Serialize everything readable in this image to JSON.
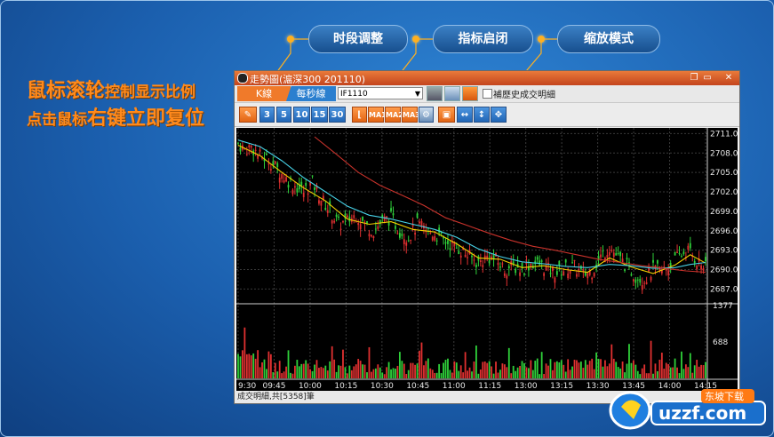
{
  "promo": {
    "line1_big": "鼠标滚轮",
    "line1_small": "控制显示比例",
    "line2_small": "点击鼠标",
    "line2_big": "右键立即复位"
  },
  "callouts": [
    "时段调整",
    "指标启闭",
    "缩放模式"
  ],
  "window": {
    "title": "走勢圖(滬深300 201110)",
    "tabs": [
      "K線",
      "每秒線"
    ],
    "contract": "IF1110",
    "checkbox_label": "補歷史成交明細",
    "period_buttons": [
      "3",
      "5",
      "10",
      "15",
      "30"
    ],
    "indicator_buttons": [
      "MA1",
      "MA2",
      "MA3"
    ],
    "status": "成交明細,共[5358]筆"
  },
  "chart_data": {
    "type": "candlestick",
    "price_axis_ticks": [
      2711.0,
      2708.0,
      2705.0,
      2702.0,
      2699.0,
      2696.0,
      2693.0,
      2690.0,
      2687.0
    ],
    "price_range": [
      2685.0,
      2711.6
    ],
    "volume_axis_ticks": [
      1377,
      688
    ],
    "volume_range": [
      0,
      1377
    ],
    "time_ticks": [
      "9:30",
      "09:45",
      "10:00",
      "10:15",
      "10:30",
      "10:45",
      "11:00",
      "11:15",
      "13:00",
      "13:15",
      "13:30",
      "13:45",
      "14:00",
      "14:15"
    ],
    "price_path": [
      [
        0,
        2709.5
      ],
      [
        3,
        2708.5
      ],
      [
        6,
        2709
      ],
      [
        10,
        2707.5
      ],
      [
        14,
        2707
      ],
      [
        18,
        2705.5
      ],
      [
        22,
        2704
      ],
      [
        26,
        2703
      ],
      [
        30,
        2702
      ],
      [
        34,
        2703.5
      ],
      [
        38,
        2701
      ],
      [
        42,
        2699
      ],
      [
        46,
        2697
      ],
      [
        50,
        2697.5
      ],
      [
        54,
        2698.5
      ],
      [
        58,
        2697
      ],
      [
        62,
        2696
      ],
      [
        66,
        2697.5
      ],
      [
        70,
        2698
      ],
      [
        74,
        2696
      ],
      [
        78,
        2695
      ],
      [
        82,
        2697
      ],
      [
        86,
        2696
      ],
      [
        90,
        2695.5
      ],
      [
        94,
        2694.5
      ],
      [
        98,
        2693.8
      ],
      [
        102,
        2693
      ],
      [
        106,
        2692
      ],
      [
        110,
        2691
      ],
      [
        114,
        2692
      ],
      [
        118,
        2691.5
      ],
      [
        122,
        2690
      ],
      [
        126,
        2690.5
      ],
      [
        130,
        2690
      ],
      [
        134,
        2691
      ],
      [
        138,
        2690.8
      ],
      [
        142,
        2690
      ],
      [
        146,
        2689.5
      ],
      [
        150,
        2690.2
      ],
      [
        154,
        2690.4
      ],
      [
        158,
        2689.2
      ],
      [
        162,
        2689.8
      ],
      [
        166,
        2692
      ],
      [
        170,
        2693.5
      ],
      [
        174,
        2691.8
      ],
      [
        178,
        2690.5
      ],
      [
        182,
        2689
      ],
      [
        186,
        2688.5
      ],
      [
        190,
        2690
      ],
      [
        194,
        2689.8
      ],
      [
        198,
        2690.6
      ],
      [
        202,
        2692.2
      ],
      [
        206,
        2693
      ],
      [
        210,
        2691.4
      ],
      [
        214,
        2690.2
      ]
    ],
    "ma_series": [
      {
        "color": "#f2d000",
        "values": [
          [
            0,
            2709.2
          ],
          [
            10,
            2707.6
          ],
          [
            20,
            2705
          ],
          [
            30,
            2702.6
          ],
          [
            40,
            2700.6
          ],
          [
            50,
            2697.8
          ],
          [
            60,
            2697
          ],
          [
            70,
            2697.4
          ],
          [
            80,
            2696.2
          ],
          [
            90,
            2695.8
          ],
          [
            100,
            2694
          ],
          [
            110,
            2691.8
          ],
          [
            120,
            2691.6
          ],
          [
            130,
            2690.3
          ],
          [
            140,
            2690.6
          ],
          [
            150,
            2690
          ],
          [
            160,
            2689.6
          ],
          [
            170,
            2691.8
          ],
          [
            180,
            2690.4
          ],
          [
            190,
            2689.4
          ],
          [
            200,
            2690.7
          ],
          [
            207,
            2692.3
          ],
          [
            214,
            2691
          ]
        ]
      },
      {
        "color": "#47d1e6",
        "values": [
          [
            0,
            2710
          ],
          [
            10,
            2709
          ],
          [
            20,
            2706.8
          ],
          [
            30,
            2704.2
          ],
          [
            40,
            2702
          ],
          [
            50,
            2699.8
          ],
          [
            60,
            2698.4
          ],
          [
            70,
            2697.8
          ],
          [
            80,
            2697
          ],
          [
            90,
            2696.2
          ],
          [
            100,
            2695
          ],
          [
            110,
            2693.2
          ],
          [
            120,
            2692
          ],
          [
            130,
            2691.2
          ],
          [
            140,
            2690.9
          ],
          [
            150,
            2690.5
          ],
          [
            160,
            2690.3
          ],
          [
            170,
            2690.8
          ],
          [
            180,
            2690.6
          ],
          [
            190,
            2690.2
          ],
          [
            200,
            2690.3
          ],
          [
            207,
            2690.8
          ],
          [
            214,
            2691.1
          ]
        ]
      },
      {
        "color": "#c8322b",
        "values": [
          [
            35,
            2710.5
          ],
          [
            45,
            2707.8
          ],
          [
            55,
            2705
          ],
          [
            65,
            2703
          ],
          [
            75,
            2701.5
          ],
          [
            85,
            2699.9
          ],
          [
            95,
            2698
          ],
          [
            105,
            2696.8
          ],
          [
            115,
            2695.6
          ],
          [
            125,
            2694.5
          ],
          [
            135,
            2693.6
          ],
          [
            145,
            2693
          ],
          [
            155,
            2692.3
          ],
          [
            165,
            2691.6
          ],
          [
            175,
            2691.1
          ],
          [
            185,
            2690.6
          ],
          [
            195,
            2690.2
          ],
          [
            205,
            2689.8
          ],
          [
            214,
            2689.6
          ]
        ]
      }
    ]
  }
}
